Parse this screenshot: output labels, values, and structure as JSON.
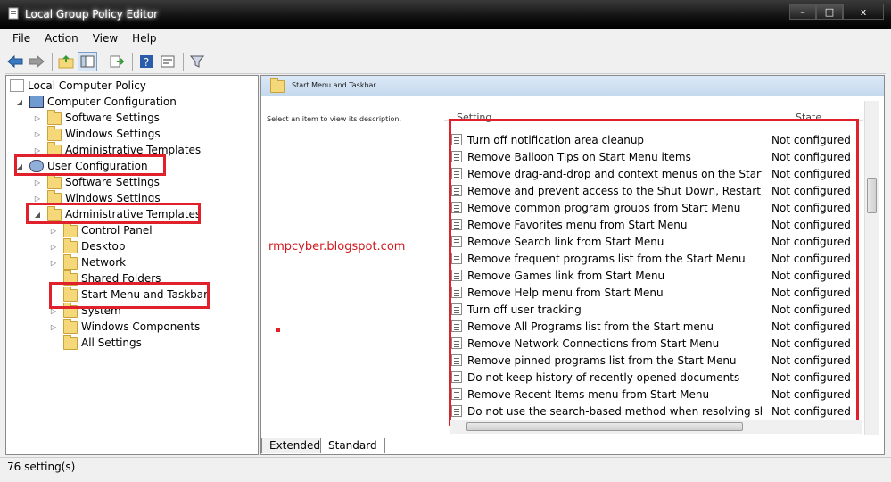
{
  "window": {
    "title": "Local Group Policy Editor",
    "min": "–",
    "max": "□",
    "close": "x"
  },
  "menu": [
    "File",
    "Action",
    "View",
    "Help"
  ],
  "tree": {
    "root": "Local Computer Policy",
    "computer_config": "Computer Configuration",
    "cc_software": "Software Settings",
    "cc_windows": "Windows Settings",
    "cc_admin": "Administrative Templates",
    "user_config": "User Configuration",
    "uc_software": "Software Settings",
    "uc_windows": "Windows Settings",
    "uc_admin": "Administrative Templates",
    "control_panel": "Control Panel",
    "desktop": "Desktop",
    "network": "Network",
    "shared_folders": "Shared Folders",
    "start_menu": "Start Menu and Taskbar",
    "system": "System",
    "windows_components": "Windows Components",
    "all_settings": "All Settings"
  },
  "right": {
    "header": "Start Menu and Taskbar",
    "description": "Select an item to view its description.",
    "watermark": "rmpcyber.blogspot.com",
    "col_setting": "Setting",
    "col_state": "State"
  },
  "settings": [
    {
      "name": "Turn off notification area cleanup",
      "state": "Not configured"
    },
    {
      "name": "Remove Balloon Tips on Start Menu items",
      "state": "Not configured"
    },
    {
      "name": "Remove drag-and-drop and context menus on the Start Me...",
      "state": "Not configured"
    },
    {
      "name": "Remove and prevent access to the Shut Down, Restart, Sleep...",
      "state": "Not configured"
    },
    {
      "name": "Remove common program groups from Start Menu",
      "state": "Not configured"
    },
    {
      "name": "Remove Favorites menu from Start Menu",
      "state": "Not configured"
    },
    {
      "name": "Remove Search link from Start Menu",
      "state": "Not configured"
    },
    {
      "name": "Remove frequent programs list from the Start Menu",
      "state": "Not configured"
    },
    {
      "name": "Remove Games link from Start Menu",
      "state": "Not configured"
    },
    {
      "name": "Remove Help menu from Start Menu",
      "state": "Not configured"
    },
    {
      "name": "Turn off user tracking",
      "state": "Not configured"
    },
    {
      "name": "Remove All Programs list from the Start menu",
      "state": "Not configured"
    },
    {
      "name": "Remove Network Connections from Start Menu",
      "state": "Not configured"
    },
    {
      "name": "Remove pinned programs list from the Start Menu",
      "state": "Not configured"
    },
    {
      "name": "Do not keep history of recently opened documents",
      "state": "Not configured"
    },
    {
      "name": "Remove Recent Items menu from Start Menu",
      "state": "Not configured"
    },
    {
      "name": "Do not use the search-based method when resolving shell s...",
      "state": "Not configured"
    }
  ],
  "tabs": {
    "extended": "Extended",
    "standard": "Standard"
  },
  "status": "76 setting(s)",
  "colors": {
    "highlight_box": "#e0202a",
    "watermark": "#d1171d"
  }
}
